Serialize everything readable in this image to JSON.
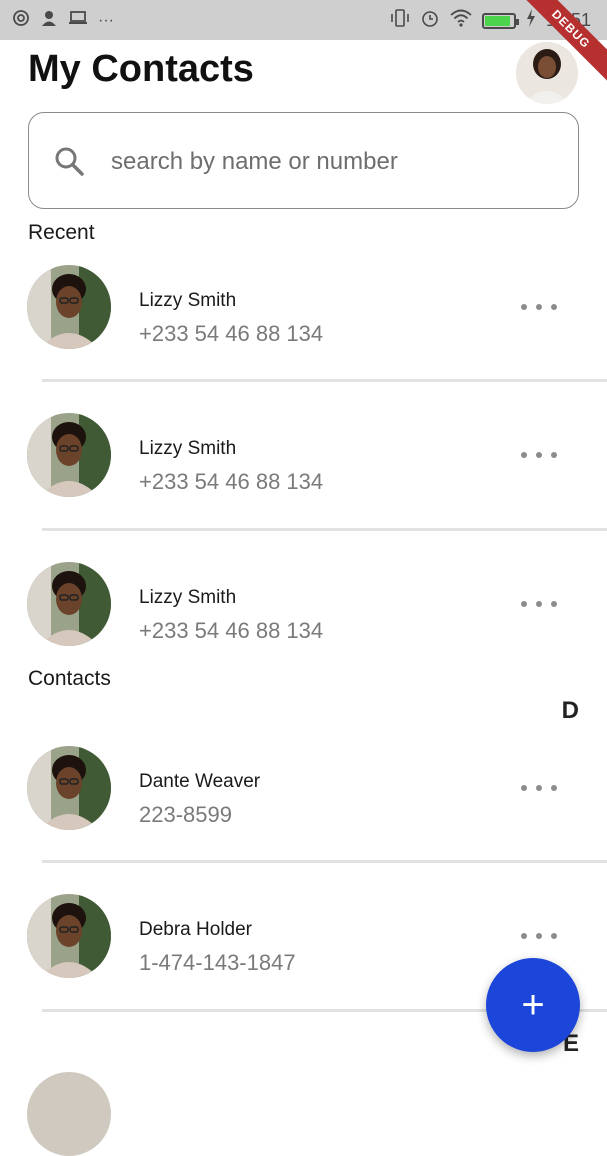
{
  "status_bar": {
    "time": "10:51",
    "battery_level": 0.9,
    "left_icons": [
      "at-sign-icon",
      "person-icon",
      "laptop-icon",
      "more-dots-icon"
    ],
    "right_icons": [
      "vibrate-icon",
      "alarm-icon",
      "wifi-icon",
      "battery-icon",
      "charging-icon"
    ]
  },
  "debug_banner": "DEBUG",
  "header": {
    "title": "My Contacts"
  },
  "search": {
    "placeholder": "search by name or number"
  },
  "sections": {
    "recent": "Recent",
    "contacts": "Contacts"
  },
  "recent": [
    {
      "name": "Lizzy Smith",
      "number": "+233 54 46 88 134"
    },
    {
      "name": "Lizzy Smith",
      "number": "+233 54 46 88 134"
    },
    {
      "name": "Lizzy Smith",
      "number": "+233 54 46 88 134"
    }
  ],
  "letter_headers": [
    "D",
    "E"
  ],
  "contacts": [
    {
      "name": "Dante Weaver",
      "number": "223-8599"
    },
    {
      "name": "Debra Holder",
      "number": "1-474-143-1847"
    }
  ],
  "fab": {
    "label": "+"
  },
  "colors": {
    "accent": "#1c46d9",
    "status_bar": "#cfcfcf",
    "debug": "#b5302f"
  }
}
